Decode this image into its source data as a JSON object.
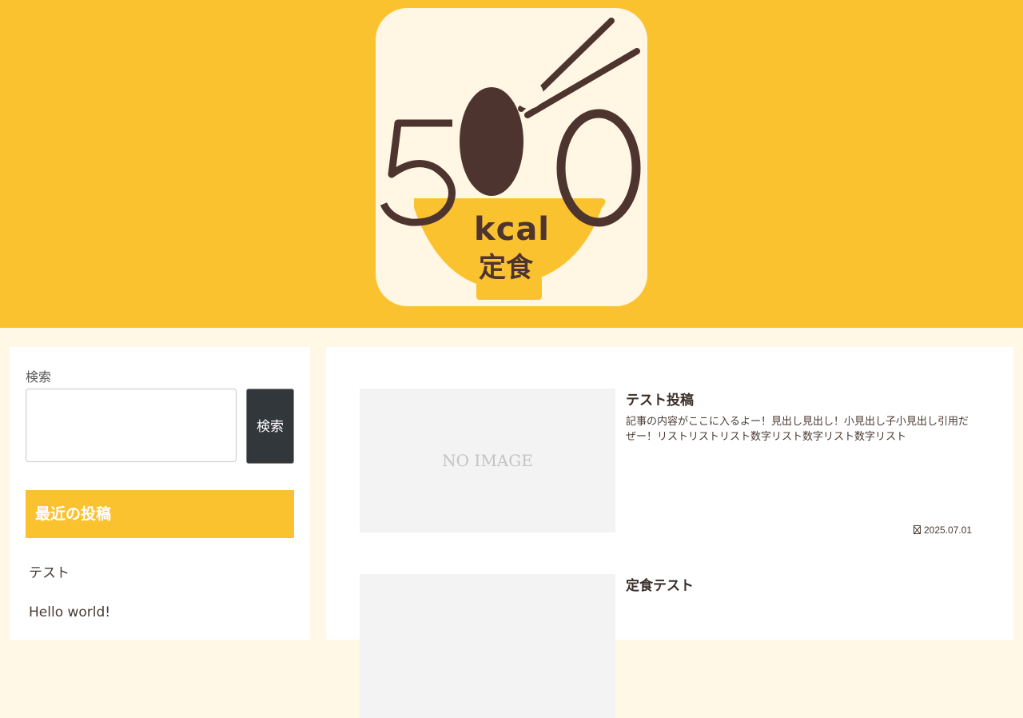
{
  "header": {
    "logo": {
      "text_number": "500",
      "text_unit": "kcal",
      "text_name": "定食",
      "colors": {
        "background": "#fff6e3",
        "brown": "#4e342e",
        "yellow": "#fbc22f"
      }
    },
    "background_color": "#fbc22f"
  },
  "sidebar": {
    "search": {
      "label": "検索",
      "placeholder": "",
      "value": "",
      "button_label": "検索"
    },
    "recent_posts": {
      "title": "最近の投稿",
      "items": [
        {
          "label": "テスト"
        },
        {
          "label": "Hello world!"
        }
      ]
    }
  },
  "main": {
    "posts": [
      {
        "thumbnail_text": "NO IMAGE",
        "title": "テスト投稿",
        "excerpt": "記事の内容がここに入るよー！見出し見出し！小見出し子小見出し引用だぜー！リストリストリスト数字リスト数字リスト数字リスト",
        "date": "2025.07.01",
        "date_icon": "clock-icon"
      },
      {
        "thumbnail_text": "",
        "title": "定食テスト",
        "excerpt": "",
        "date": ""
      }
    ]
  },
  "colors": {
    "accent": "#fbc22f",
    "page_background": "#fff8e6",
    "button_dark": "#32373c",
    "text": "#4a3a33"
  }
}
